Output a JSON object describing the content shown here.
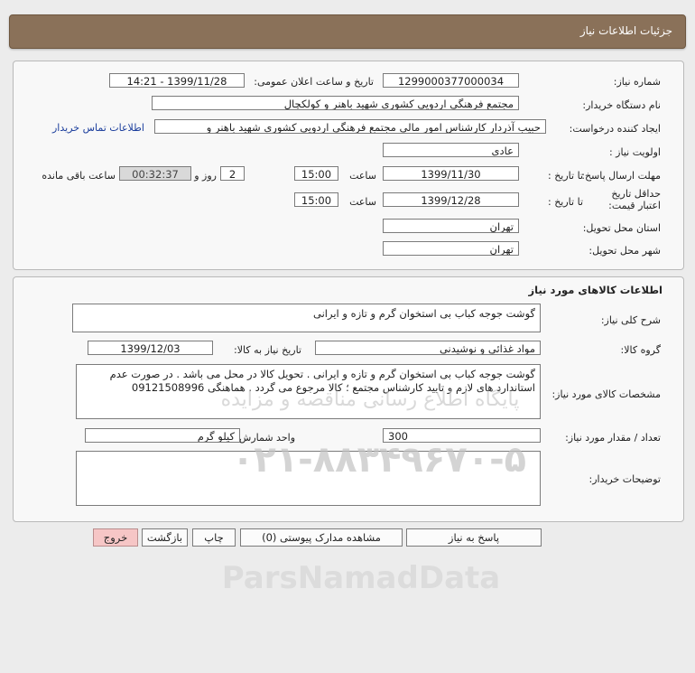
{
  "header": {
    "title": "جزئیات اطلاعات نیاز"
  },
  "info": {
    "need_number_label": "شماره نیاز:",
    "need_number": "1299000377000034",
    "announce_label": "تاریخ و ساعت اعلان عمومی:",
    "announce_value": "1399/11/28 - 14:21",
    "buyer_label": "نام دستگاه خریدار:",
    "buyer_value": "مجتمع فرهنگی اردویی کشوری شهید باهنر و کولکچال",
    "requester_label": "ایجاد کننده درخواست:",
    "requester_value": "حبیب آذردار کارشناس امور مالی  مجتمع فرهنگی اردویی کشوری شهید باهنر و",
    "contact_link": "اطلاعات تماس خریدار",
    "priority_label": "اولویت نیاز :",
    "priority_value": "عادی",
    "deadline_label": "مهلت ارسال پاسخ:",
    "to_date_label": "تا تاریخ :",
    "deadline_date": "1399/11/30",
    "hour_label": "ساعت",
    "deadline_hour": "15:00",
    "days_value": "2",
    "days_label": "روز و",
    "remaining_time": "00:32:37",
    "remaining_label": "ساعت باقی مانده",
    "validity_label": "حداقل تاریخ اعتبار قیمت:",
    "validity_to_label": "تا تاریخ :",
    "validity_date": "1399/12/28",
    "validity_hour_label": "ساعت",
    "validity_hour": "15:00",
    "province_label": "استان محل تحویل:",
    "province_value": "تهران",
    "city_label": "شهر محل تحویل:",
    "city_value": "تهران"
  },
  "goods": {
    "section_title": "اطلاعات کالاهای مورد نیاز",
    "summary_label": "شرح کلی نیاز:",
    "summary_value": "گوشت جوجه کباب بی استخوان گرم و تازه و ایرانی",
    "group_label": "گروه کالا:",
    "group_value": "مواد غذائی و نوشیدنی",
    "need_date_label": "تاریخ نیاز به کالا:",
    "need_date_value": "1399/12/03",
    "specs_label": "مشخصات کالای مورد نیاز:",
    "specs_value": "گوشت جوجه کباب بی استخوان گرم و تازه و ایرانی . تحویل کالا در محل می باشد . در صورت عدم استاندارد های لازم و تایید کارشناس مجتمع ؛ کالا مرجوع می گردد . هماهنگی 09121508996",
    "qty_label": "تعداد / مقدار مورد نیاز:",
    "qty_value": "300",
    "unit_label": "واحد شمارش:",
    "unit_value": "کیلو گرم",
    "buyer_notes_label": "توضیحات خریدار:",
    "buyer_notes_value": ""
  },
  "buttons": {
    "reply": "پاسخ به نیاز",
    "attachments": "مشاهده مدارک پیوستی (0)",
    "print": "چاپ",
    "back": "بازگشت",
    "exit": "خروج"
  },
  "watermark": {
    "brand": "ParsNamadData",
    "sub": "پایگاه اطلاع رسانی مناقصه و مزایده",
    "phone": "۰۲۱-۸۸۳۴۹۶۷۰-۵"
  }
}
